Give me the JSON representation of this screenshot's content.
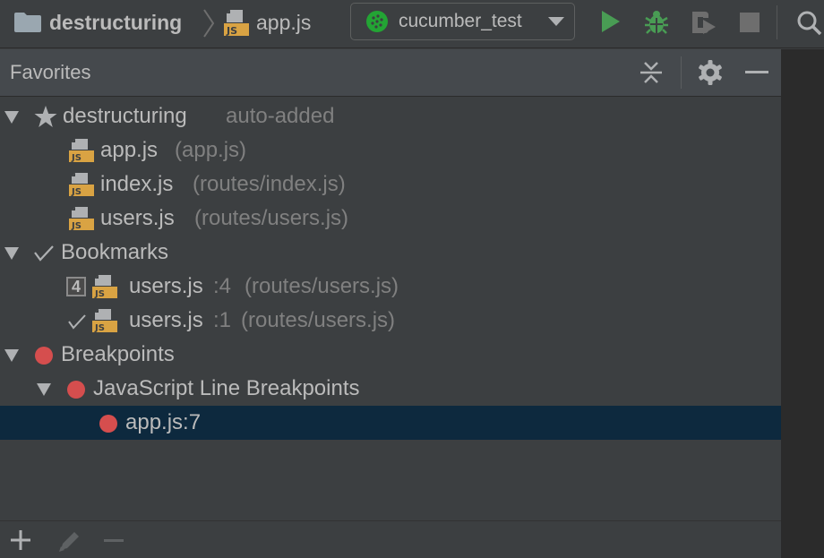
{
  "navbar": {
    "project_name": "destructuring",
    "file_name": "app.js",
    "run_config": "cucumber_test"
  },
  "icons": {
    "folder": "folder-icon",
    "js_file": "js-file-icon",
    "cucumber": "cucumber-icon",
    "run": "run-icon",
    "debug": "debug-icon",
    "coverage": "run-with-coverage-icon",
    "stop": "stop-icon",
    "search": "search-icon",
    "collapse": "collapse-all-icon",
    "settings": "gear-icon",
    "hide": "minimize-icon",
    "add": "plus-icon",
    "edit": "pencil-icon",
    "remove": "minus-icon"
  },
  "colors": {
    "run_green": "#499c54",
    "breakpoint_red": "#d54e4e",
    "selection": "#0d293e",
    "js_yellow": "#d9a343"
  },
  "panel": {
    "title": "Favorites"
  },
  "tree": {
    "favorites": {
      "label": "destructuring",
      "suffix": "auto-added",
      "items": [
        {
          "name": "app.js",
          "path": "(app.js)"
        },
        {
          "name": "index.js",
          "path": "(routes/index.js)"
        },
        {
          "name": "users.js",
          "path": "(routes/users.js)"
        }
      ]
    },
    "bookmarks": {
      "label": "Bookmarks",
      "items": [
        {
          "mnemonic": "4",
          "name": "users.js",
          "line": ":4",
          "path": "(routes/users.js)"
        },
        {
          "mnemonic": "",
          "name": "users.js",
          "line": ":1",
          "path": "(routes/users.js)"
        }
      ]
    },
    "breakpoints": {
      "label": "Breakpoints",
      "group": "JavaScript Line Breakpoints",
      "items": [
        {
          "name": "app.js:7"
        }
      ]
    }
  }
}
